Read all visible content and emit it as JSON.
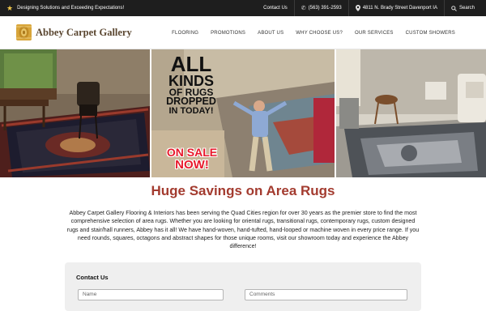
{
  "topbar": {
    "tagline": "Designing Solutions and Exceeding Expectations!",
    "contact_label": "Contact Us",
    "phone": "(563) 391-2593",
    "address": "4811 N. Brady Street Davenport IA",
    "search_label": "Search"
  },
  "header": {
    "brand": "Abbey Carpet Gallery",
    "nav": [
      "FLOORING",
      "PROMOTIONS",
      "ABOUT US",
      "WHY CHOOSE US?",
      "OUR SERVICES",
      "CUSTOM SHOWERS"
    ]
  },
  "hero": {
    "promo_lines": [
      "ALL",
      "KINDS",
      "OF RUGS",
      "DROPPED",
      "IN TODAY!"
    ],
    "sale_lines": [
      "ON SALE",
      "NOW!"
    ]
  },
  "main": {
    "headline": "Huge Savings on Area Rugs",
    "intro": "Abbey Carpet Gallery Flooring & Interiors has been serving the Quad Cities region for over 30 years as the premier store to find the most comprehensive selection of area rugs. Whether you are looking for oriental rugs, transitional rugs, contemporary rugs, custom designed rugs and stair/hall runners, Abbey has it all! We have hand-woven, hand-tufted, hand-looped or machine woven in every price range.  If you need rounds, squares, octagons and abstract shapes for those unique rooms, visit our showroom today and experience the Abbey difference!"
  },
  "contact_form": {
    "title": "Contact Us",
    "name_placeholder": "Name",
    "comments_placeholder": "Comments"
  },
  "colors": {
    "topbar_bg": "#1e1e1e",
    "accent_star": "#f2c94c",
    "headline": "#a33b2f",
    "brand_text": "#5a4630",
    "sale_text": "#e8192c"
  }
}
